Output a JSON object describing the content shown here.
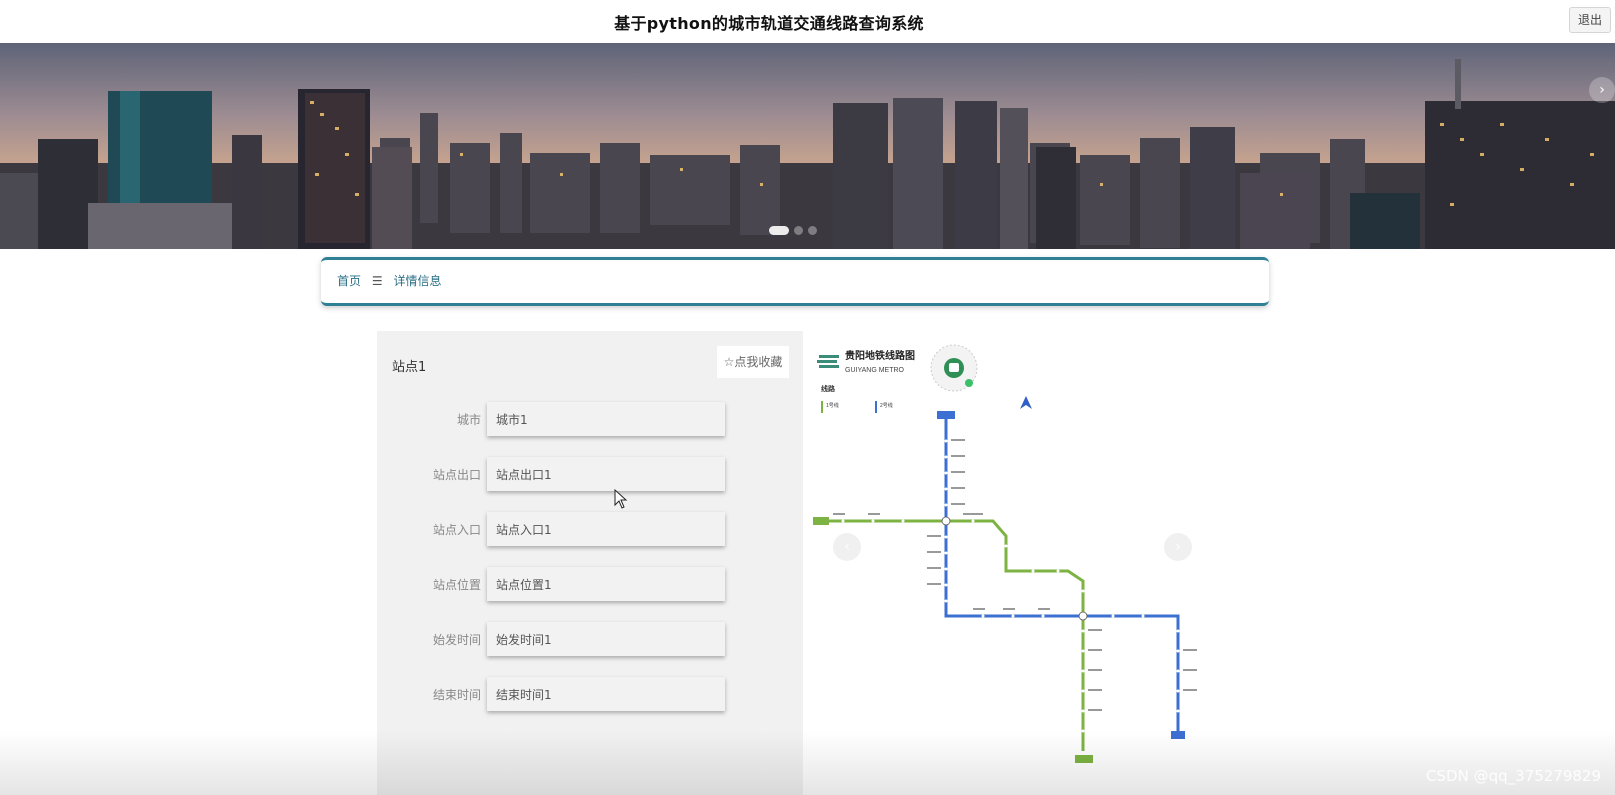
{
  "header": {
    "title": "基于python的城市轨道交通线路查询系统",
    "logout_label": "退出"
  },
  "banner": {
    "next_arrow": "›",
    "slides_total": 3,
    "active_slide": 1
  },
  "breadcrumb": {
    "home": "首页",
    "separator": "☰",
    "current": "详情信息"
  },
  "detail": {
    "station_title": "站点1",
    "favorite_label": "☆点我收藏",
    "fields": [
      {
        "label": "城市",
        "value": "城市1"
      },
      {
        "label": "站点出口",
        "value": "站点出口1"
      },
      {
        "label": "站点入口",
        "value": "站点入口1"
      },
      {
        "label": "站点位置",
        "value": "站点位置1"
      },
      {
        "label": "始发时间",
        "value": "始发时间1"
      },
      {
        "label": "结束时间",
        "value": "结束时间1"
      }
    ]
  },
  "map_image": {
    "title_cn": "贵阳地铁线路图",
    "title_en": "GUIYANG METRO",
    "section_label": "线路",
    "line1_name": "1号线",
    "line2_name": "2号线",
    "line1_color": "#7cb342",
    "line2_color": "#3b6fd1",
    "prev_arrow": "‹",
    "next_arrow": "›"
  },
  "watermark": "CSDN @qq_375279829",
  "colors": {
    "accent": "#2f7f95",
    "card_bg": "#f1f1f1"
  }
}
